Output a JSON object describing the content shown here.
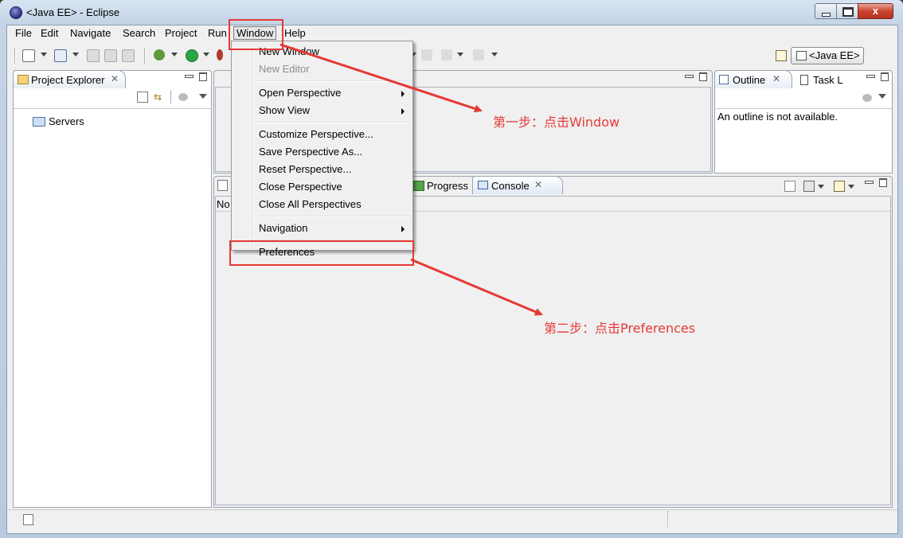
{
  "window": {
    "title": "<Java EE> - Eclipse",
    "close_glyph": "x"
  },
  "menubar": [
    "File",
    "Edit",
    "Navigate",
    "Search",
    "Project",
    "Run",
    "Window",
    "Help"
  ],
  "perspective": {
    "label": "<Java EE>"
  },
  "project_explorer": {
    "tab_label": "Project Explorer",
    "items": [
      {
        "label": "Servers"
      }
    ]
  },
  "outline": {
    "tab_label": "Outline",
    "task_tab_label": "Task L",
    "message": "An outline is not available."
  },
  "bottom_panel": {
    "progress_tab": "Progress",
    "console_tab": "Console",
    "partial_text": "No"
  },
  "window_menu": {
    "items": [
      {
        "label": "New Window",
        "enabled": true,
        "submenu": false
      },
      {
        "label": "New Editor",
        "enabled": false,
        "submenu": false
      },
      {
        "label": "Open Perspective",
        "enabled": true,
        "submenu": true
      },
      {
        "label": "Show View",
        "enabled": true,
        "submenu": true
      },
      {
        "label": "Customize Perspective...",
        "enabled": true,
        "submenu": false
      },
      {
        "label": "Save Perspective As...",
        "enabled": true,
        "submenu": false
      },
      {
        "label": "Reset Perspective...",
        "enabled": true,
        "submenu": false
      },
      {
        "label": "Close Perspective",
        "enabled": true,
        "submenu": false
      },
      {
        "label": "Close All Perspectives",
        "enabled": true,
        "submenu": false
      },
      {
        "label": "Navigation",
        "enabled": true,
        "submenu": true
      },
      {
        "label": "Preferences",
        "enabled": true,
        "submenu": false
      }
    ]
  },
  "annotations": {
    "step1": "第一步：点击Window",
    "step2": "第二步：点击Preferences",
    "color": "#e53935"
  },
  "colors": {
    "frame": "#c4d4e6",
    "client": "#f0f0f0",
    "accent_red": "#e53935"
  }
}
